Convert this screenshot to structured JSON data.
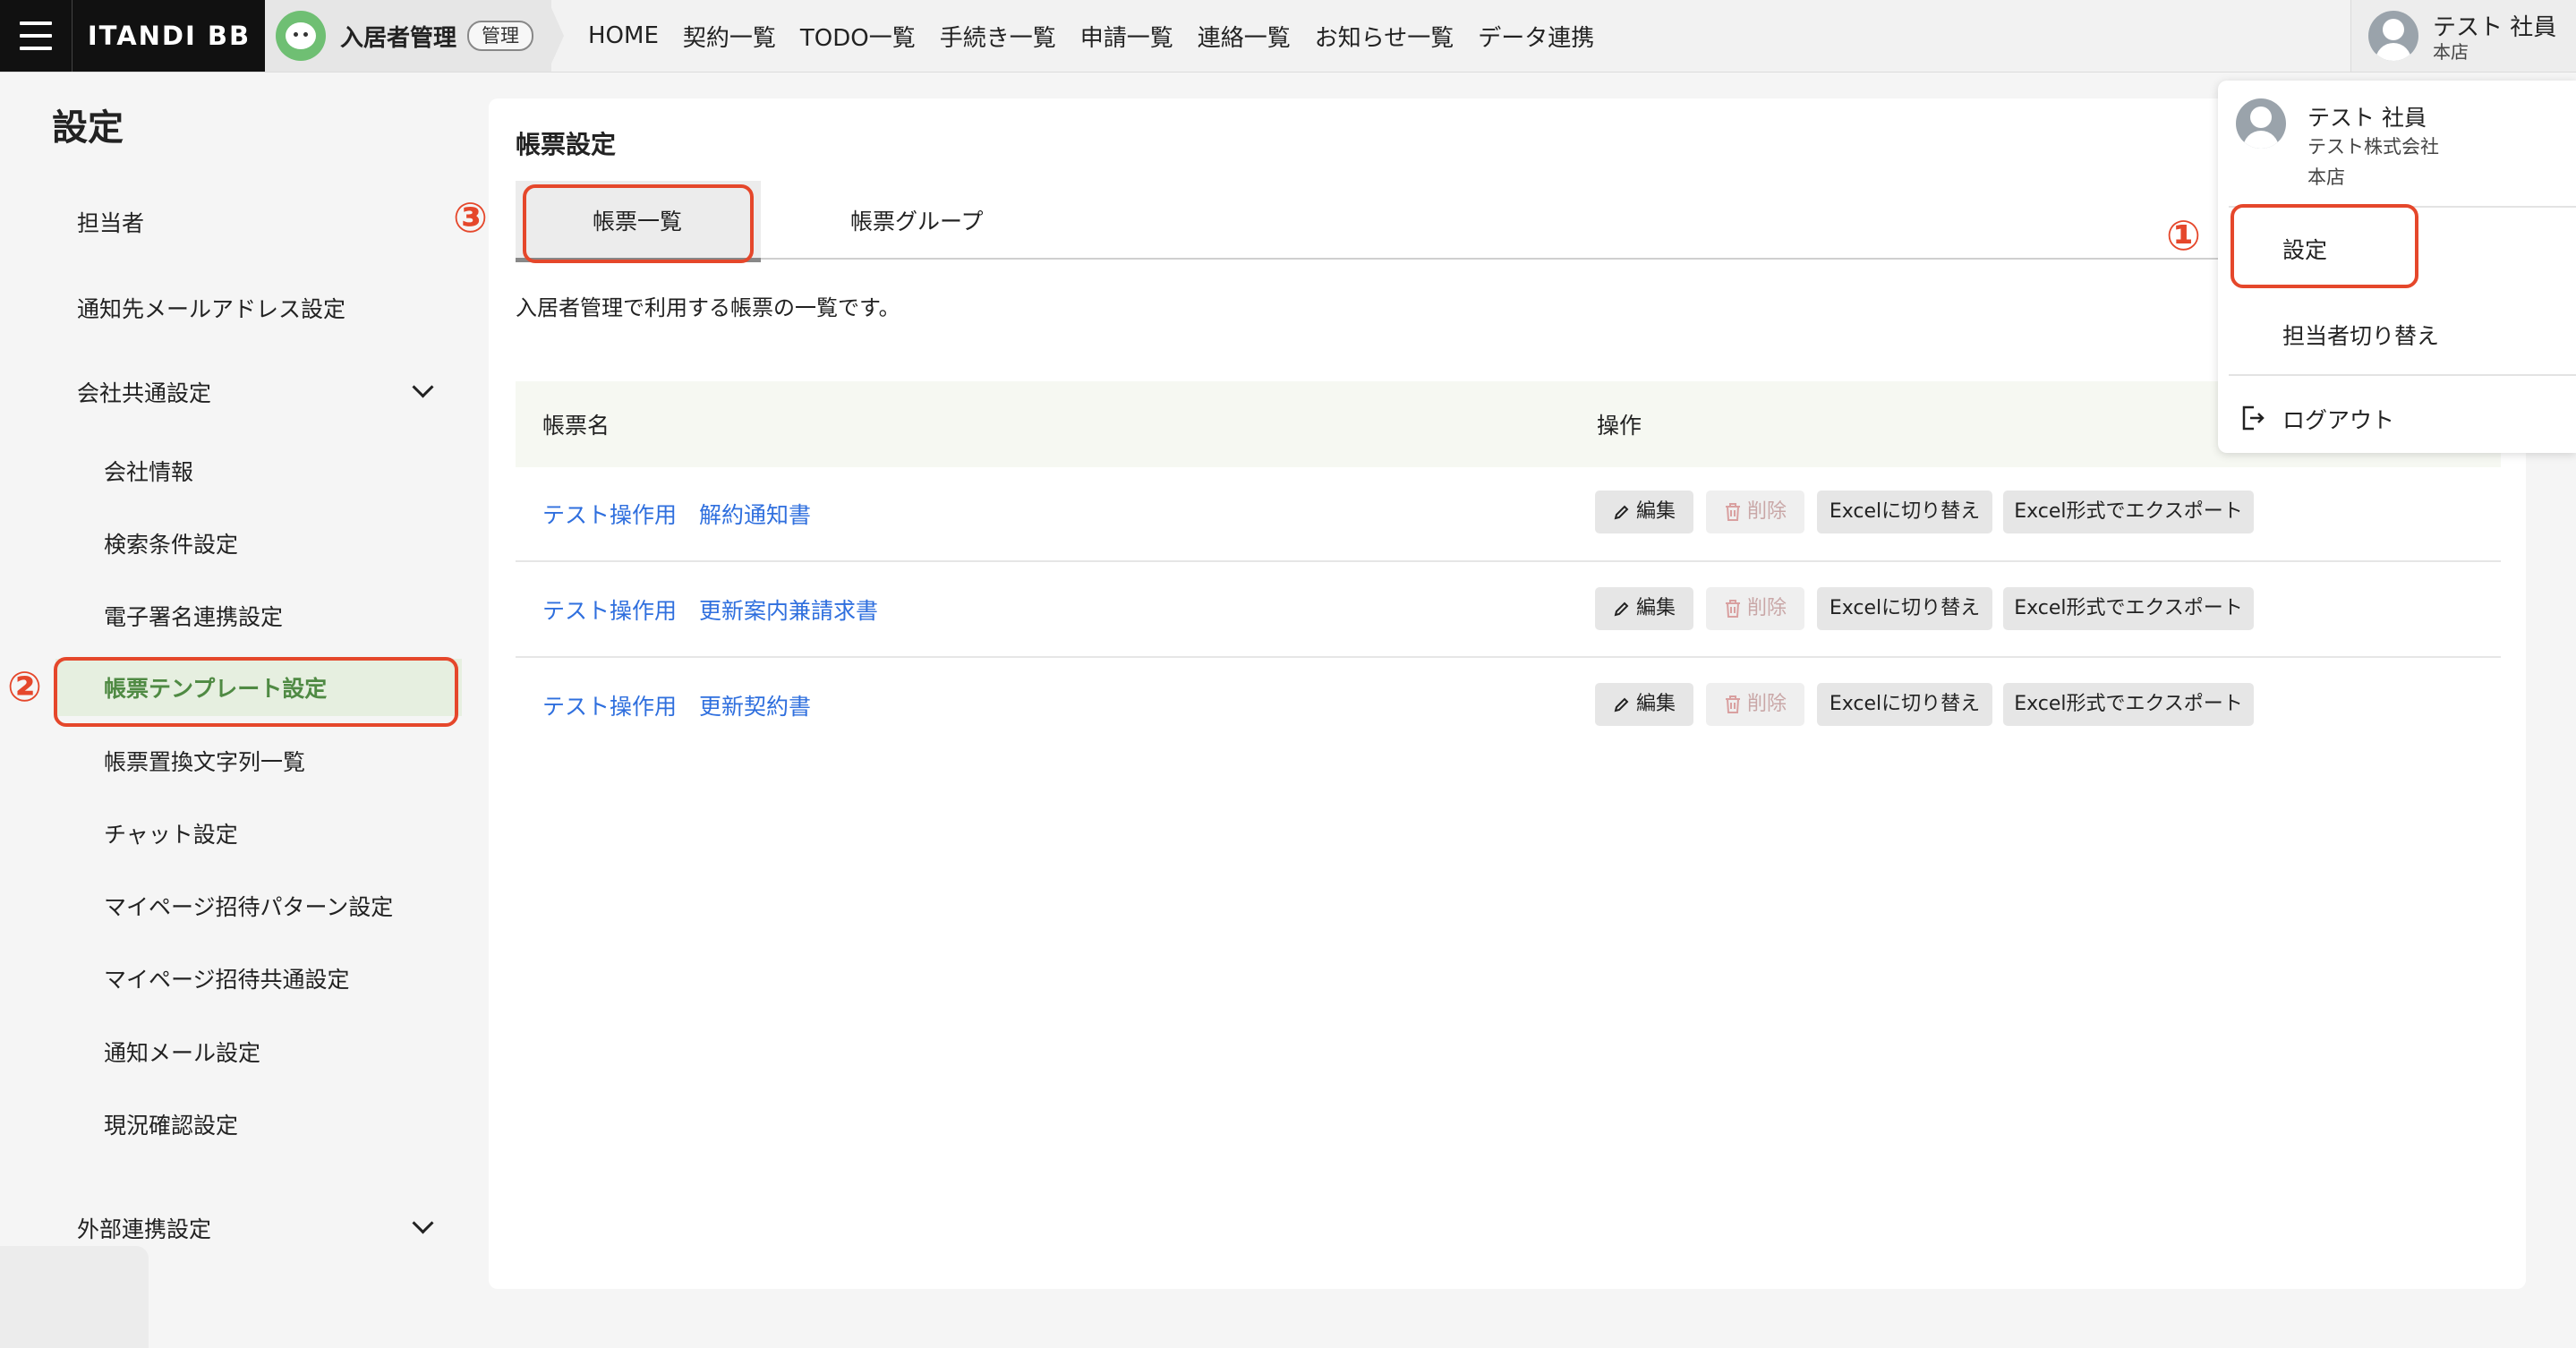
{
  "header": {
    "brand": "ITANDI BB",
    "service_name": "入居者管理",
    "service_badge": "管理",
    "nav": [
      "HOME",
      "契約一覧",
      "TODO一覧",
      "手続き一覧",
      "申請一覧",
      "連絡一覧",
      "お知らせ一覧",
      "データ連携"
    ],
    "user_name": "テスト 社員",
    "user_store": "本店"
  },
  "sidebar": {
    "title": "設定",
    "items": {
      "tantousha": "担当者",
      "notify_mail": "通知先メールアドレス設定",
      "company_common": "会社共通設定",
      "company_info": "会社情報",
      "search_condition": "検索条件設定",
      "esign": "電子署名連携設定",
      "template": "帳票テンプレート設定",
      "replace_strings": "帳票置換文字列一覧",
      "chat": "チャット設定",
      "mypage_pattern": "マイページ招待パターン設定",
      "mypage_common": "マイページ招待共通設定",
      "notify_mail_setting": "通知メール設定",
      "status_check": "現況確認設定",
      "external": "外部連携設定"
    }
  },
  "main": {
    "title": "帳票設定",
    "tabs": [
      "帳票一覧",
      "帳票グループ"
    ],
    "description": "入居者管理で利用する帳票の一覧です。",
    "columns": [
      "帳票名",
      "操作"
    ],
    "rows": [
      {
        "name": "テスト操作用　解約通知書"
      },
      {
        "name": "テスト操作用　更新案内兼請求書"
      },
      {
        "name": "テスト操作用　更新契約書"
      }
    ],
    "actions": {
      "edit": "編集",
      "delete": "削除",
      "switch_excel": "Excelに切り替え",
      "export_excel": "Excel形式でエクスポート"
    }
  },
  "dropdown": {
    "user_name": "テスト 社員",
    "company": "テスト株式会社",
    "store": "本店",
    "settings": "設定",
    "switch_user": "担当者切り替え",
    "logout": "ログアウト"
  },
  "annotations": {
    "m1": "①",
    "m2": "②",
    "m3": "③"
  },
  "colors": {
    "accent_green": "#4f8a43",
    "link_blue": "#2f6fde",
    "annotation_red": "#e5472b"
  }
}
